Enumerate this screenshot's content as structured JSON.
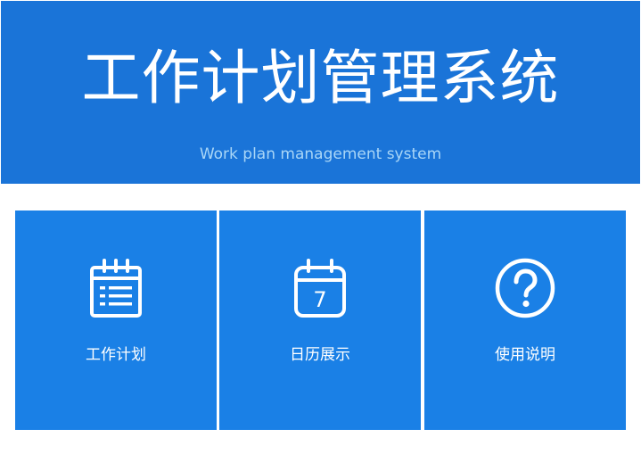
{
  "header": {
    "title": "工作计划管理系统",
    "subtitle": "Work plan management system"
  },
  "tiles": [
    {
      "label": "工作计划",
      "icon": "calendar-list-icon"
    },
    {
      "label": "日历展示",
      "icon": "calendar-day-icon",
      "day": "7"
    },
    {
      "label": "使用说明",
      "icon": "help-circle-icon"
    }
  ],
  "colors": {
    "header_bg": "#1a74d8",
    "tile_bg": "#1a80e6",
    "subtitle": "#a9d6f7",
    "text": "#ffffff"
  }
}
